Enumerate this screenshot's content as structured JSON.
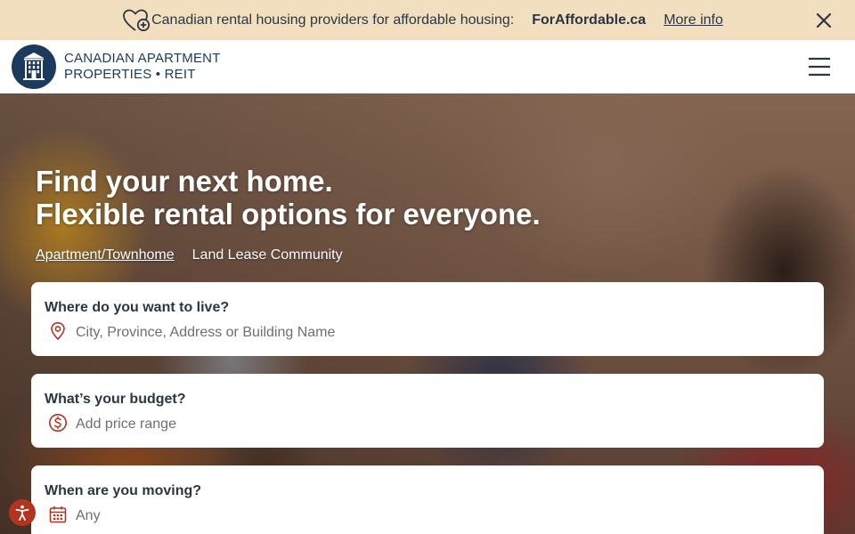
{
  "banner": {
    "text": "Canadian rental housing providers for affordable housing:",
    "brand": "ForAffordable.ca",
    "link": "More info",
    "icon": "heart-plus-icon",
    "close_icon": "close-icon"
  },
  "header": {
    "logo_line1": "CANADIAN APARTMENT",
    "logo_line2": "PROPERTIES • REIT",
    "menu_icon": "hamburger-menu-icon"
  },
  "hero": {
    "title_line1": "Find your next home.",
    "title_line2": "Flexible rental options for everyone.",
    "tabs": [
      {
        "label": "Apartment/Townhome",
        "active": true
      },
      {
        "label": "Land Lease Community",
        "active": false
      }
    ]
  },
  "search": {
    "location": {
      "label": "Where do you want to live?",
      "placeholder": "City, Province, Address or Building Name",
      "icon": "map-pin-icon"
    },
    "budget": {
      "label": "What’s your budget?",
      "placeholder": "Add price range",
      "icon": "dollar-circle-icon"
    },
    "moving": {
      "label": "When are you moving?",
      "placeholder": "Any",
      "icon": "calendar-icon"
    }
  },
  "colors": {
    "banner_bg": "#f1dfc0",
    "brand_navy": "#1c3a5c",
    "accent_red": "#b2341f",
    "text_dark": "#2c3640"
  },
  "accessibility": {
    "icon": "accessibility-icon"
  }
}
